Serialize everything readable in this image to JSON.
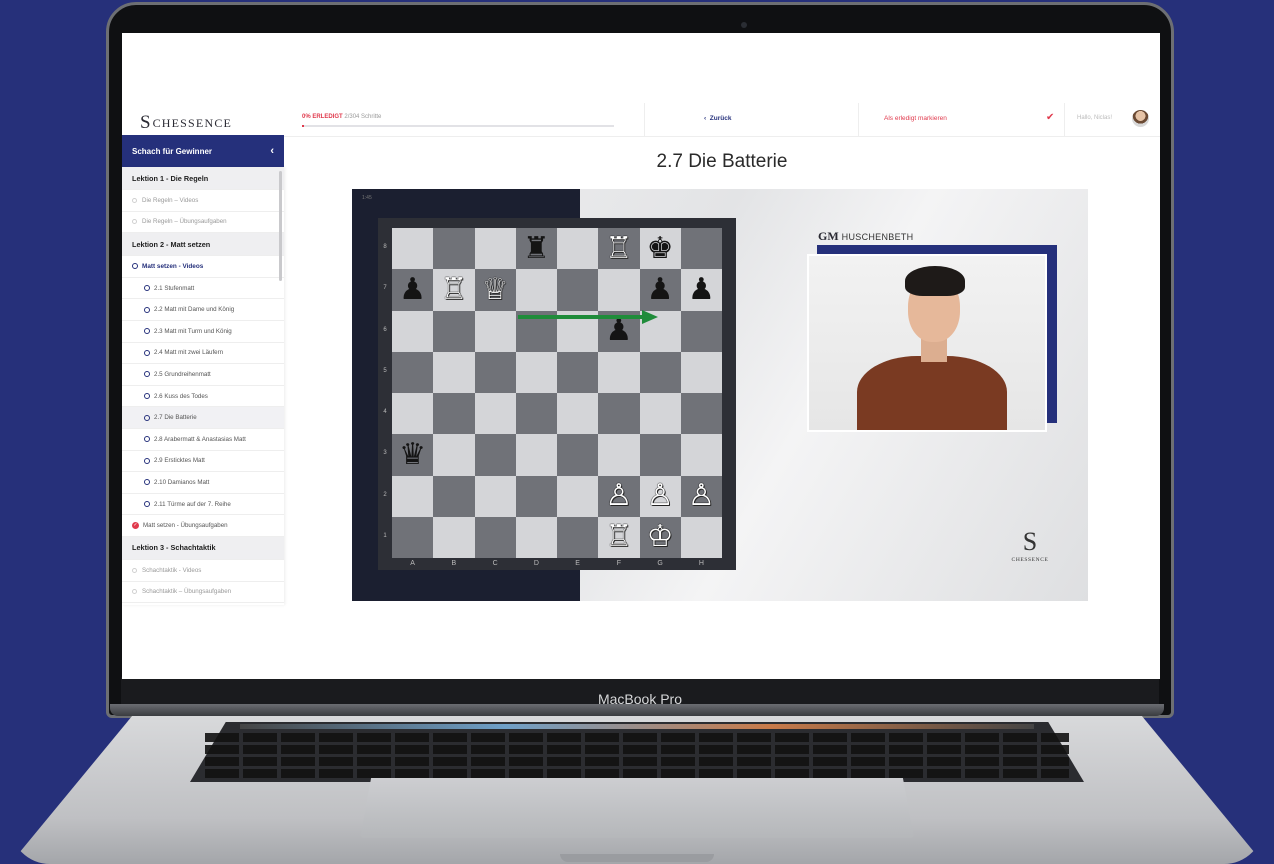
{
  "device": {
    "label": "MacBook Pro"
  },
  "app": {
    "logo_letter": "S",
    "logo_text": "CHESSENCE"
  },
  "sidebar": {
    "course_title": "Schach für Gewinner",
    "lesson1": {
      "title": "Lektion 1 - Die Regeln",
      "items": [
        "Die Regeln – Videos",
        "Die Regeln – Übungsaufgaben"
      ]
    },
    "lesson2": {
      "title": "Lektion 2 - Matt setzen",
      "section": "Matt setzen - Videos",
      "videos": [
        "2.1 Stufenmatt",
        "2.2 Matt mit Dame und König",
        "2.3 Matt mit Turm und König",
        "2.4 Matt mit zwei Läufern",
        "2.5 Grundreihenmatt",
        "2.6 Kuss des Todes",
        "2.7 Die Batterie",
        "2.8 Arabermatt & Anastasias Matt",
        "2.9 Ersticktes Matt",
        "2.10 Damianos Matt",
        "2.11 Türme auf der 7. Reihe"
      ],
      "exercises": "Matt setzen - Übungsaufgaben"
    },
    "lesson3": {
      "title": "Lektion 3 - Schachtaktik",
      "items": [
        "Schachtaktik - Videos",
        "Schachtaktik – Übungsaufgaben"
      ]
    }
  },
  "topbar": {
    "progress_pct": "0% ERLEDIGT",
    "progress_steps": "2/304 Schritte",
    "progress_fraction": 0.007,
    "back_label": "Zurück",
    "mark_done_label": "Als erledigt markieren",
    "greeting": "Hallo, Niclas!"
  },
  "lesson": {
    "title": "2.7 Die Batterie"
  },
  "video": {
    "timer": "1:45",
    "gm_title": "GM",
    "gm_name": "HUSCHENBETH",
    "brand_letter": "S",
    "brand_text": "CHESSENCE",
    "board": {
      "files": [
        "A",
        "B",
        "C",
        "D",
        "E",
        "F",
        "G",
        "H"
      ],
      "ranks": [
        "8",
        "7",
        "6",
        "5",
        "4",
        "3",
        "2",
        "1"
      ],
      "squares": [
        [
          "",
          "",
          "",
          "♜",
          "",
          "♖",
          "♚",
          ""
        ],
        [
          "♟",
          "♖",
          "♕",
          "",
          "",
          "",
          "♟",
          "♟"
        ],
        [
          "",
          "",
          "",
          "",
          "",
          "♟",
          "",
          ""
        ],
        [
          "",
          "",
          "",
          "",
          "",
          "",
          "",
          ""
        ],
        [
          "",
          "",
          "",
          "",
          "",
          "",
          "",
          ""
        ],
        [
          "♛",
          "",
          "",
          "",
          "",
          "",
          "",
          ""
        ],
        [
          "",
          "",
          "",
          "",
          "",
          "♙",
          "♙",
          "♙"
        ],
        [
          "",
          "",
          "",
          "",
          "",
          "♖",
          "♔",
          ""
        ]
      ],
      "arrow": {
        "from": "c7",
        "to": "g7",
        "color": "#1f8c3a"
      }
    }
  },
  "colors": {
    "navy": "#25307b",
    "accent": "#e03a4d",
    "background": "#26307a"
  }
}
